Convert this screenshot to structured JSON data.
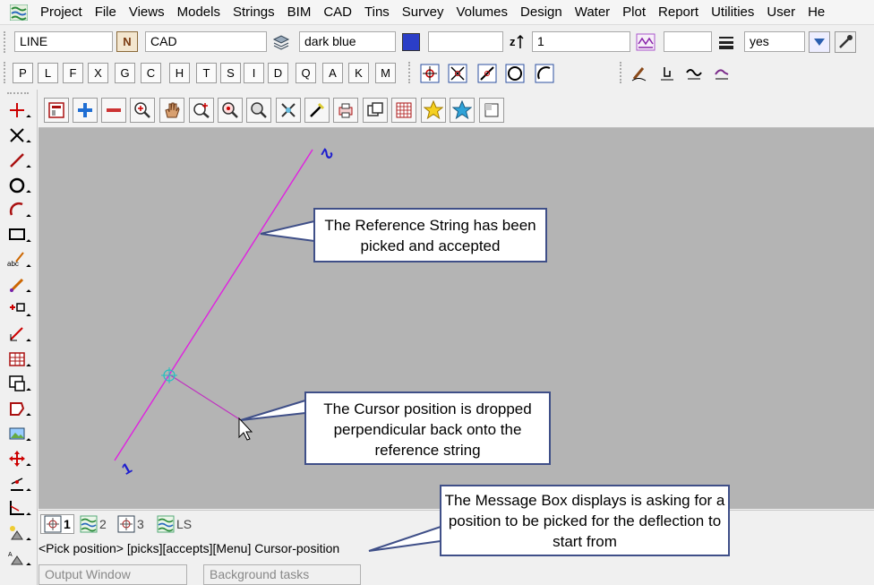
{
  "menu": [
    "Project",
    "File",
    "Views",
    "Models",
    "Strings",
    "BIM",
    "CAD",
    "Tins",
    "Survey",
    "Volumes",
    "Design",
    "Water",
    "Plot",
    "Report",
    "Utilities",
    "User",
    "He"
  ],
  "toolbar": {
    "string_name": "LINE",
    "name_button": "N",
    "model": "CAD",
    "colour": "dark blue",
    "colour_swatch": "#2b3ec7",
    "linestyle": "",
    "z_value": "1",
    "weight": "",
    "yes_value": "yes"
  },
  "letters": [
    "P",
    "L",
    "F",
    "X",
    "G",
    "C",
    "H",
    "T",
    "S",
    "I",
    "D",
    "Q",
    "A",
    "K",
    "M"
  ],
  "left_tools": [
    "point-icon",
    "cross-icon",
    "line-icon",
    "circle-icon",
    "arc-icon",
    "rectangle-icon",
    "text-icon",
    "pen-icon",
    "symbol-icon",
    "dimension-icon",
    "table-icon",
    "view-icon",
    "polygon-icon",
    "image-icon",
    "move-icon",
    "edit-icon",
    "axis-icon",
    "node-icon",
    "alpha-icon"
  ],
  "view_tools": [
    "window-icon",
    "zoom-in-icon",
    "zoom-out-icon",
    "zoom-window-icon",
    "pan-icon",
    "zoom-center-icon",
    "zoom-extent-icon",
    "zoom-previous-icon",
    "pick-icon",
    "erase-icon",
    "plot-icon",
    "copy-icon",
    "grid-icon",
    "favourite-icon",
    "bookmark-icon",
    "restore-icon"
  ],
  "canvas": {
    "string_start_label": "1",
    "string_end_label": "2",
    "callout_reference": "The Reference String has been picked and accepted",
    "callout_cursor": "The Cursor position is dropped perpendicular back onto the reference string",
    "callout_message": "The Message Box displays  is asking for a position to be picked for the deflection to start from"
  },
  "view_tabs": [
    {
      "label": "1",
      "active": true
    },
    {
      "label": "2",
      "active": false
    },
    {
      "label": "3",
      "active": false
    },
    {
      "label": "LS",
      "active": false
    }
  ],
  "message": "<Pick position> [picks][accepts][Menu] Cursor-position",
  "bottom_tabs": [
    "Output Window",
    "Background tasks"
  ]
}
